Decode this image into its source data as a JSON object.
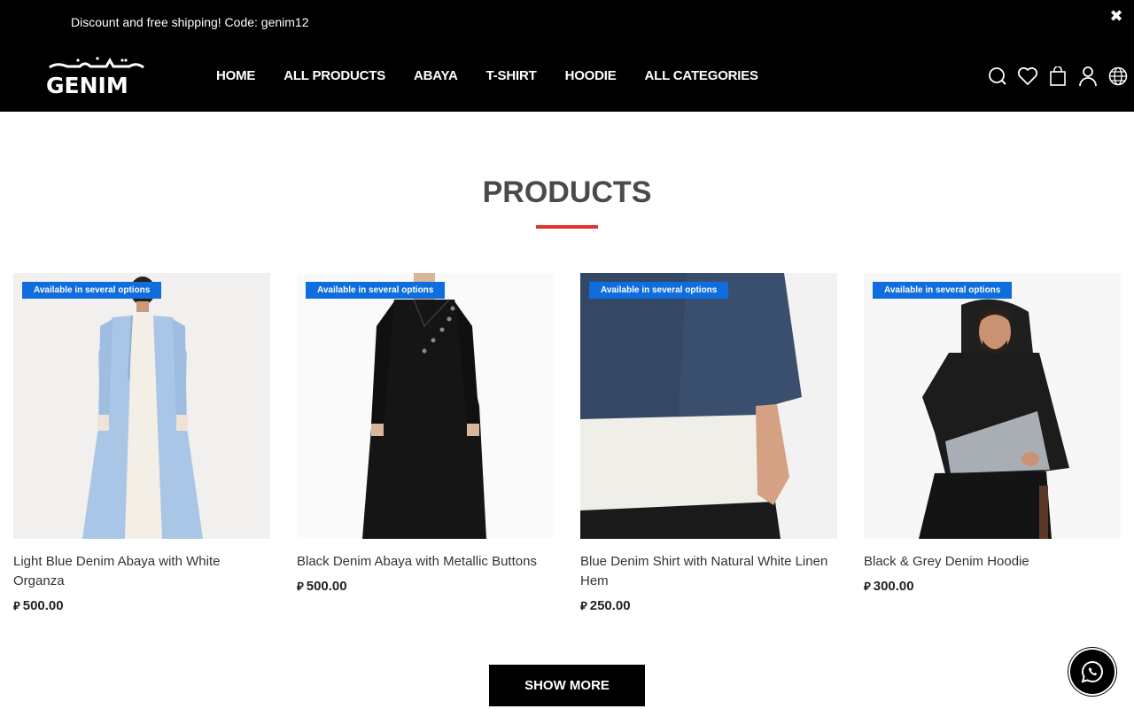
{
  "announcement": {
    "text": "Discount and free shipping! Code: genim12",
    "close_icon": "close-icon"
  },
  "logo": {
    "text": "GENIM"
  },
  "nav": {
    "items": [
      {
        "label": "HOME"
      },
      {
        "label": "ALL PRODUCTS"
      },
      {
        "label": "ABAYA"
      },
      {
        "label": "T-SHIRT"
      },
      {
        "label": "HOODIE"
      },
      {
        "label": "ALL CATEGORIES"
      }
    ]
  },
  "header_icons": [
    "search-icon",
    "heart-icon",
    "bag-icon",
    "user-icon",
    "globe-icon"
  ],
  "section": {
    "title": "PRODUCTS",
    "underline_color": "#e3342f"
  },
  "products": [
    {
      "badge": "Available in several options",
      "name": "Light Blue Denim Abaya with White Organza",
      "currency": "⃁",
      "price": "500.00"
    },
    {
      "badge": "Available in several options",
      "name": "Black Denim Abaya with Metallic Buttons",
      "currency": "⃁",
      "price": "500.00"
    },
    {
      "badge": "Available in several options",
      "name": "Blue Denim Shirt with Natural White Linen Hem",
      "currency": "⃁",
      "price": "250.00"
    },
    {
      "badge": "Available in several options",
      "name": "Black & Grey Denim Hoodie",
      "currency": "⃁",
      "price": "300.00"
    }
  ],
  "show_more": {
    "label": "SHOW MORE"
  },
  "whatsapp": {
    "icon": "whatsapp-icon"
  },
  "colors": {
    "header_bg": "#000000",
    "badge_bg": "#0f6dde",
    "accent": "#e3342f"
  }
}
